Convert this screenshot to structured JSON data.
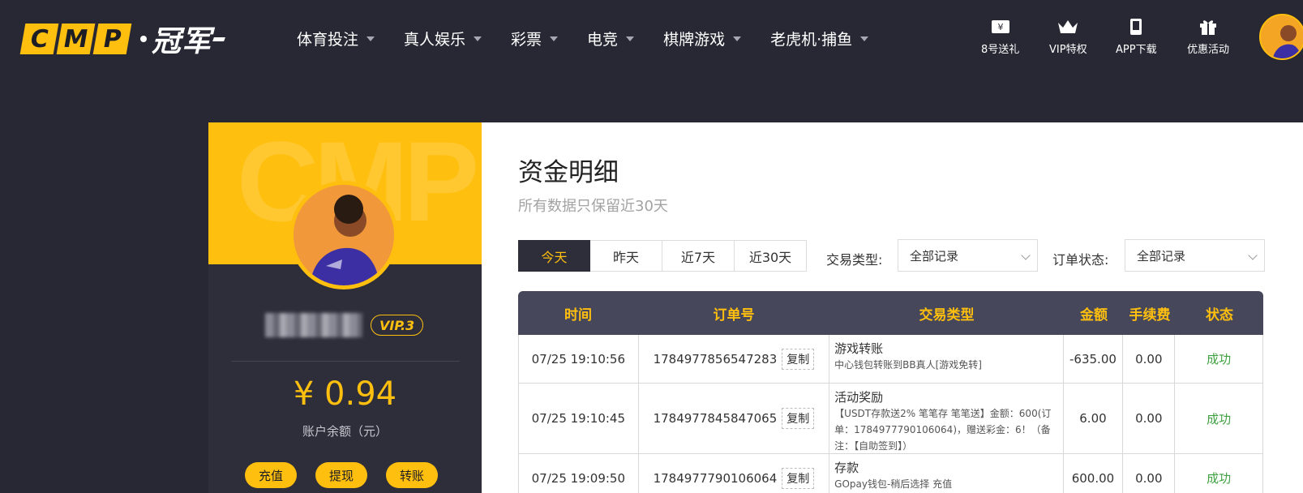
{
  "header": {
    "logo_letters": [
      "C",
      "M",
      "P"
    ],
    "logo_cn": "冠军",
    "nav": [
      "体育投注",
      "真人娱乐",
      "彩票",
      "电竞",
      "棋牌游戏",
      "老虎机·捕鱼"
    ],
    "quick": [
      {
        "label": "8号送礼",
        "icon": "gift-ticket-icon"
      },
      {
        "label": "VIP特权",
        "icon": "crown-icon"
      },
      {
        "label": "APP下载",
        "icon": "phone-icon"
      },
      {
        "label": "优惠活动",
        "icon": "gift-box-icon"
      }
    ]
  },
  "sidebar": {
    "watermark": "CMP",
    "vip": "VIP.3",
    "balance": "¥ 0.94",
    "balance_label": "账户余额（元）",
    "actions": [
      "充值",
      "提现",
      "转账"
    ]
  },
  "main": {
    "title": "资金明细",
    "subtitle": "所有数据只保留近30天",
    "tabs": [
      "今天",
      "昨天",
      "近7天",
      "近30天"
    ],
    "active_tab": "今天",
    "filters": {
      "type_label": "交易类型:",
      "type_value": "全部记录",
      "status_label": "订单状态:",
      "status_value": "全部记录"
    },
    "table": {
      "headers": [
        "时间",
        "订单号",
        "交易类型",
        "金额",
        "手续费",
        "状态"
      ],
      "copy_label": "复制",
      "rows": [
        {
          "time": "07/25 19:10:56",
          "order": "1784977856547283",
          "type": "游戏转账",
          "detail": "中心钱包转账到BB真人[游戏免转]",
          "amount": "-635.00",
          "fee": "0.00",
          "status": "成功"
        },
        {
          "time": "07/25 19:10:45",
          "order": "1784977845847065",
          "type": "活动奖励",
          "detail": "【USDT存款送2% 笔笔存 笔笔送】金额：600(订单：1784977790106064)，赠送彩金：6！（备注：【自助签到】）",
          "amount": "6.00",
          "fee": "0.00",
          "status": "成功"
        },
        {
          "time": "07/25 19:09:50",
          "order": "1784977790106064",
          "type": "存款",
          "detail": "GOpay钱包-稍后选择 充值",
          "amount": "600.00",
          "fee": "0.00",
          "status": "成功"
        }
      ]
    }
  },
  "colors": {
    "accent": "#ffbf0f",
    "header_bg": "#272833",
    "table_head_bg": "#46475a",
    "success": "#3fa040"
  }
}
